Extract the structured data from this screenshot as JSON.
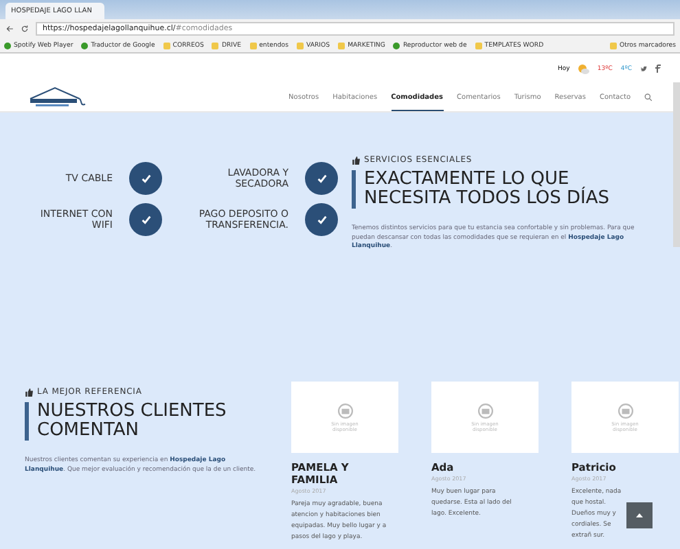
{
  "browser": {
    "tab_title": "HOSPEDAJE LAGO LLAN",
    "url_host": "https://hospedajelagollanquihue.cl/",
    "url_path": "#comodidades",
    "bookmarks": [
      {
        "label": "Spotify Web Player",
        "kind": "site"
      },
      {
        "label": "Traductor de Google",
        "kind": "site"
      },
      {
        "label": "CORREOS",
        "kind": "folder"
      },
      {
        "label": "DRIVE",
        "kind": "folder"
      },
      {
        "label": "entendos",
        "kind": "folder"
      },
      {
        "label": "VARIOS",
        "kind": "folder"
      },
      {
        "label": "MARKETING",
        "kind": "folder"
      },
      {
        "label": "Reproductor web de",
        "kind": "site"
      },
      {
        "label": "TEMPLATES WORD",
        "kind": "folder"
      }
    ],
    "other_bookmarks": "Otros marcadores"
  },
  "weather": {
    "day": "Hoy",
    "high": "13ºC",
    "low": "4ºC"
  },
  "nav": [
    {
      "label": "Nosotros",
      "selected": false
    },
    {
      "label": "Habitaciones",
      "selected": false
    },
    {
      "label": "Comodidades",
      "selected": true
    },
    {
      "label": "Comentarios",
      "selected": false
    },
    {
      "label": "Turismo",
      "selected": false
    },
    {
      "label": "Reservas",
      "selected": false
    },
    {
      "label": "Contacto",
      "selected": false
    }
  ],
  "amenities": [
    {
      "label": "TV CABLE",
      "checked": true
    },
    {
      "label": "LAVADORA Y SECADORA",
      "checked": true
    },
    {
      "label": "INTERNET CON WIFI",
      "checked": true
    },
    {
      "label": "PAGO DEPOSITO O TRANSFERENCIA.",
      "checked": true
    }
  ],
  "services": {
    "kicker": "SERVICIOS ESENCIALES",
    "heading": "EXACTAMENTE LO QUE NECESITA TODOS LOS DÍAS",
    "body": "Tenemos distintos servicios para que tu estancia sea confortable y sin problemas. Para que puedan descansar con todas las comodidades que se requieran en el **Hospedaje Lago Llanquihue**."
  },
  "reviews": {
    "kicker": "LA MEJOR REFERENCIA",
    "heading": "NUESTROS CLIENTES COMENTAN",
    "body": "Nuestros clientes comentan su experiencia en **Hospedaje Lago Llanquihue**. Que mejor evaluación y recomendación que la de un cliente.",
    "items": [
      {
        "name": "PAMELA Y FAMILIA",
        "date": "Agosto 2017",
        "text": "Pareja muy agradable, buena atencion y habitaciones bien equipadas. Muy bello lugar y a pasos del lago y playa.",
        "image_text": "Sin imagen disponible"
      },
      {
        "name": "Ada",
        "date": "Agosto 2017",
        "text": "Muy buen lugar para quedarse. Esta al lado del lago. Excelente.",
        "image_text": "Sin imagen disponible"
      },
      {
        "name": "Patricio",
        "date": "Agosto 2017",
        "text": "Excelente, nada que hostal. Dueños muy y cordiales. Se extrañ sur.",
        "image_text": "Sin imagen disponible"
      }
    ]
  }
}
